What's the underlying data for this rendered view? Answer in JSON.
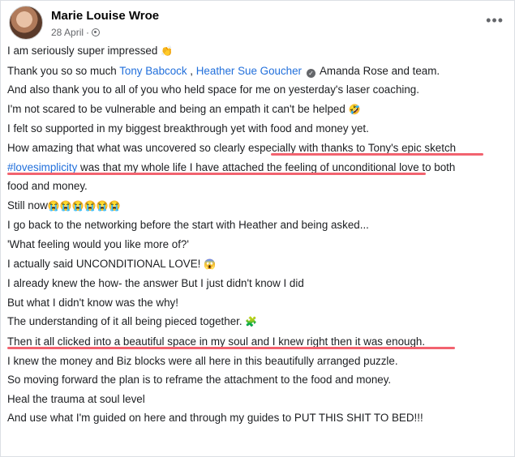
{
  "post": {
    "author": "Marie Louise Wroe",
    "date": "28 April",
    "separator": "·",
    "more_label": "•••",
    "lines": [
      {
        "text": "I am seriously super impressed",
        "emoji": "👏"
      },
      {
        "pre": "Thank you so so much ",
        "link1": "Tony Babcock",
        "mid": " , ",
        "link2": "Heather Sue Goucher",
        "post": " Amanda Rose  and team."
      },
      {
        "text": "And also thank you to all of you who held space for me on yesterday's laser coaching."
      },
      {
        "text": "I'm not scared to be vulnerable and being an empath it can't be helped",
        "emoji": "🤣"
      },
      {
        "text": "I felt so supported in my biggest breakthrough yet with food and money yet."
      },
      {
        "text": "How amazing that what was uncovered so clearly especially with thanks to Tony's epic sketch"
      },
      {
        "hashtag": "#lovesimplicity",
        "text": " was that my whole life I have attached the feeling of unconditional love to both"
      },
      {
        "text": "food and money."
      },
      {
        "text": "Still now",
        "emoji": "😭😭😭😭😭😭"
      },
      {
        "text": "I go back to the networking before the start with Heather and being asked..."
      },
      {
        "text": "'What feeling would you like more of?'"
      },
      {
        "text": "I actually said UNCONDITIONAL LOVE!",
        "emoji": "😱"
      },
      {
        "text": "I already knew the how- the answer But I just didn't know I did"
      },
      {
        "text": "But what I didn't know was the why!"
      },
      {
        "text": "The understanding of it all being pieced together.",
        "emoji": "🧩"
      },
      {
        "text": "Then it all clicked into a beautiful space in my soul and I knew right then it was enough."
      },
      {
        "text": "I knew the money and Biz blocks were all here in this beautifully arranged puzzle."
      },
      {
        "text": "So moving forward the plan is to reframe the attachment to the food and money."
      },
      {
        "text": "Heal the trauma at soul level"
      },
      {
        "text": "And use what I'm guided on here and through my guides to PUT THIS SHIT TO BED!!!"
      }
    ]
  },
  "colors": {
    "link": "#216fdb",
    "highlight_underline": "#f2636f",
    "meta": "#65676b"
  },
  "icons": {
    "avatar": "profile-photo",
    "visibility": "globe-icon",
    "verified": "verified-badge-icon",
    "more": "more-options-icon"
  }
}
